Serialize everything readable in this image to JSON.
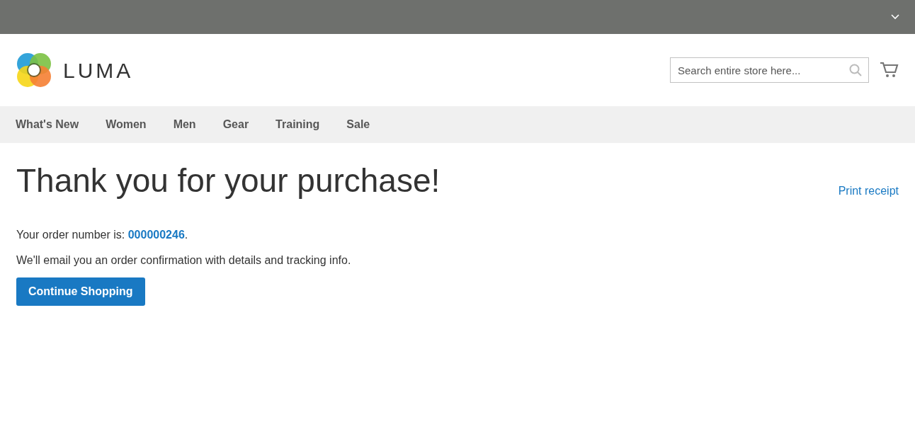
{
  "header": {
    "logo_text": "LUMA",
    "search": {
      "placeholder": "Search entire store here..."
    }
  },
  "nav": {
    "items": [
      {
        "label": "What's New"
      },
      {
        "label": "Women"
      },
      {
        "label": "Men"
      },
      {
        "label": "Gear"
      },
      {
        "label": "Training"
      },
      {
        "label": "Sale"
      }
    ]
  },
  "page": {
    "title": "Thank you for your purchase!",
    "print_link": "Print receipt",
    "order_line": {
      "prefix": "Your order number is: ",
      "order_number": "000000246",
      "suffix": "."
    },
    "message": "We'll email you an order confirmation with details and tracking info.",
    "button": "Continue Shopping"
  }
}
